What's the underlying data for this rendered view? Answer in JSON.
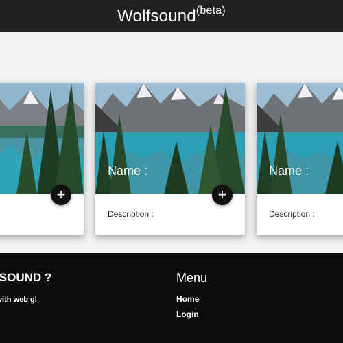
{
  "header": {
    "brand": "Wolfsound",
    "brand_sup": "(beta)"
  },
  "cards": [
    {
      "name": "",
      "description": "",
      "action_icon": "plus-icon",
      "action_label": "+"
    },
    {
      "name": "Name :",
      "description": "Description :",
      "action_icon": "plus-icon",
      "action_label": "+"
    },
    {
      "name": "Name :",
      "description": "Description :",
      "action_icon": "plus-icon",
      "action_label": "+"
    }
  ],
  "footer": {
    "about_title": "LFSOUND ?",
    "about_text": "nd with web gl",
    "menu_title": "Menu",
    "menu_items": [
      "Home",
      "Login"
    ]
  },
  "colors": {
    "header_bg": "#222222",
    "footer_bg": "#0c0c0c",
    "page_bg": "#f3f3f3",
    "fab_bg": "#111111"
  }
}
